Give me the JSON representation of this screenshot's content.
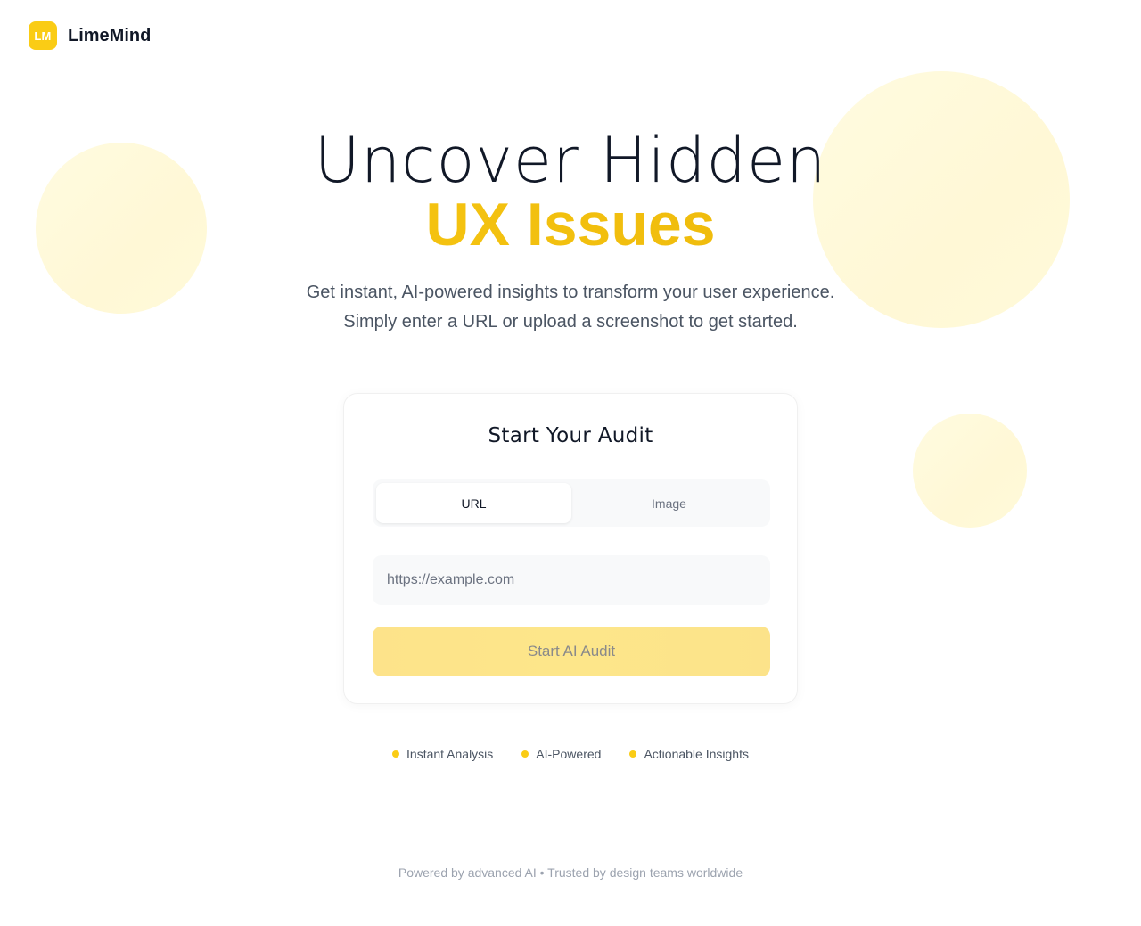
{
  "brand": {
    "logo_initials": "LM",
    "name": "LimeMind"
  },
  "hero": {
    "title_line1": "Uncover Hidden",
    "title_line2": "UX Issues",
    "subtitle_line1": "Get instant, AI-powered insights to transform your user experience.",
    "subtitle_line2": "Simply enter a URL or upload a screenshot to get started."
  },
  "audit_card": {
    "title": "Start Your Audit",
    "tabs": [
      {
        "label": "URL",
        "active": true
      },
      {
        "label": "Image",
        "active": false
      }
    ],
    "url_input": {
      "value": "",
      "placeholder": "https://example.com"
    },
    "submit_label": "Start AI Audit"
  },
  "features": [
    {
      "label": "Instant Analysis"
    },
    {
      "label": "AI-Powered"
    },
    {
      "label": "Actionable Insights"
    }
  ],
  "footer": {
    "text": "Powered by advanced AI • Trusted by design teams worldwide"
  },
  "colors": {
    "accent": "#facc15",
    "accent_dark": "#eab308",
    "text_primary": "#111827",
    "text_secondary": "#4b5563",
    "text_muted": "#9ca3af",
    "blob": "#fff8d6"
  }
}
